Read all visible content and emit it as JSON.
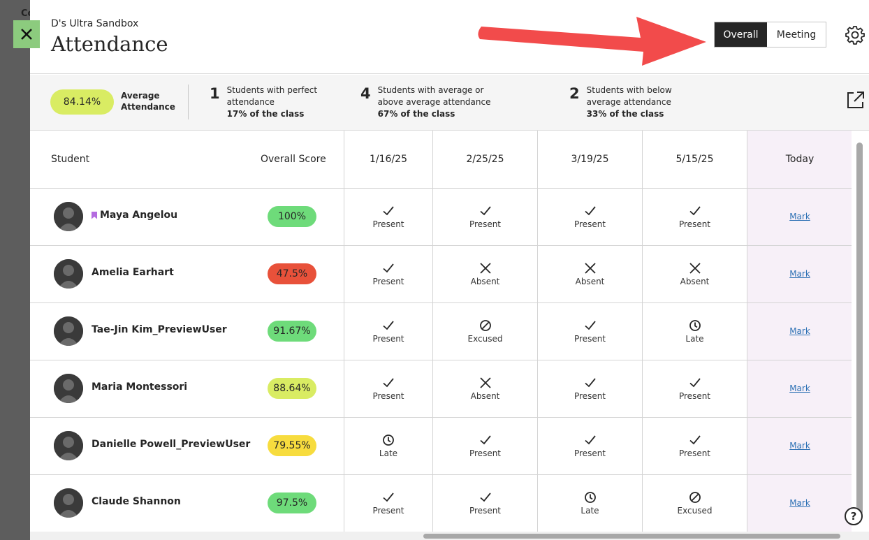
{
  "header": {
    "course_name": "D's Ultra Sandbox",
    "title": "Attendance",
    "view_toggle": {
      "overall": "Overall",
      "meeting": "Meeting",
      "selected": "Overall"
    }
  },
  "summary": {
    "average_value": "84.14%",
    "average_label": "Average Attendance",
    "stats": [
      {
        "count": "1",
        "label": "Students with perfect attendance",
        "percent": "17% of the class"
      },
      {
        "count": "4",
        "label": "Students with average or above average attendance",
        "percent": "67% of the class"
      },
      {
        "count": "2",
        "label": "Students with below average attendance",
        "percent": "33% of the class"
      }
    ]
  },
  "table": {
    "headers": {
      "student": "Student",
      "score": "Overall Score",
      "dates": [
        "1/16/25",
        "2/25/25",
        "3/19/25",
        "5/15/25"
      ],
      "today": "Today"
    },
    "mark_label": "Mark",
    "rows": [
      {
        "name": "Maya Angelou",
        "score": "100%",
        "score_color": "#6edb7a",
        "bookmark": true,
        "statuses": [
          "Present",
          "Present",
          "Present",
          "Present"
        ]
      },
      {
        "name": "Amelia Earhart",
        "score": "47.5%",
        "score_color": "#e8513a",
        "bookmark": false,
        "statuses": [
          "Present",
          "Absent",
          "Absent",
          "Absent"
        ]
      },
      {
        "name": "Tae-Jin Kim_PreviewUser",
        "score": "91.67%",
        "score_color": "#6edb7a",
        "bookmark": false,
        "statuses": [
          "Present",
          "Excused",
          "Present",
          "Late"
        ]
      },
      {
        "name": "Maria Montessori",
        "score": "88.64%",
        "score_color": "#d9ec63",
        "bookmark": false,
        "statuses": [
          "Present",
          "Absent",
          "Present",
          "Present"
        ]
      },
      {
        "name": "Danielle Powell_PreviewUser",
        "score": "79.55%",
        "score_color": "#f7dc3e",
        "bookmark": false,
        "statuses": [
          "Late",
          "Present",
          "Present",
          "Present"
        ]
      },
      {
        "name": "Claude Shannon",
        "score": "97.5%",
        "score_color": "#6edb7a",
        "bookmark": false,
        "statuses": [
          "Present",
          "Present",
          "Late",
          "Excused"
        ]
      }
    ]
  },
  "background": {
    "partial_text": "Co"
  },
  "help_glyph": "?"
}
